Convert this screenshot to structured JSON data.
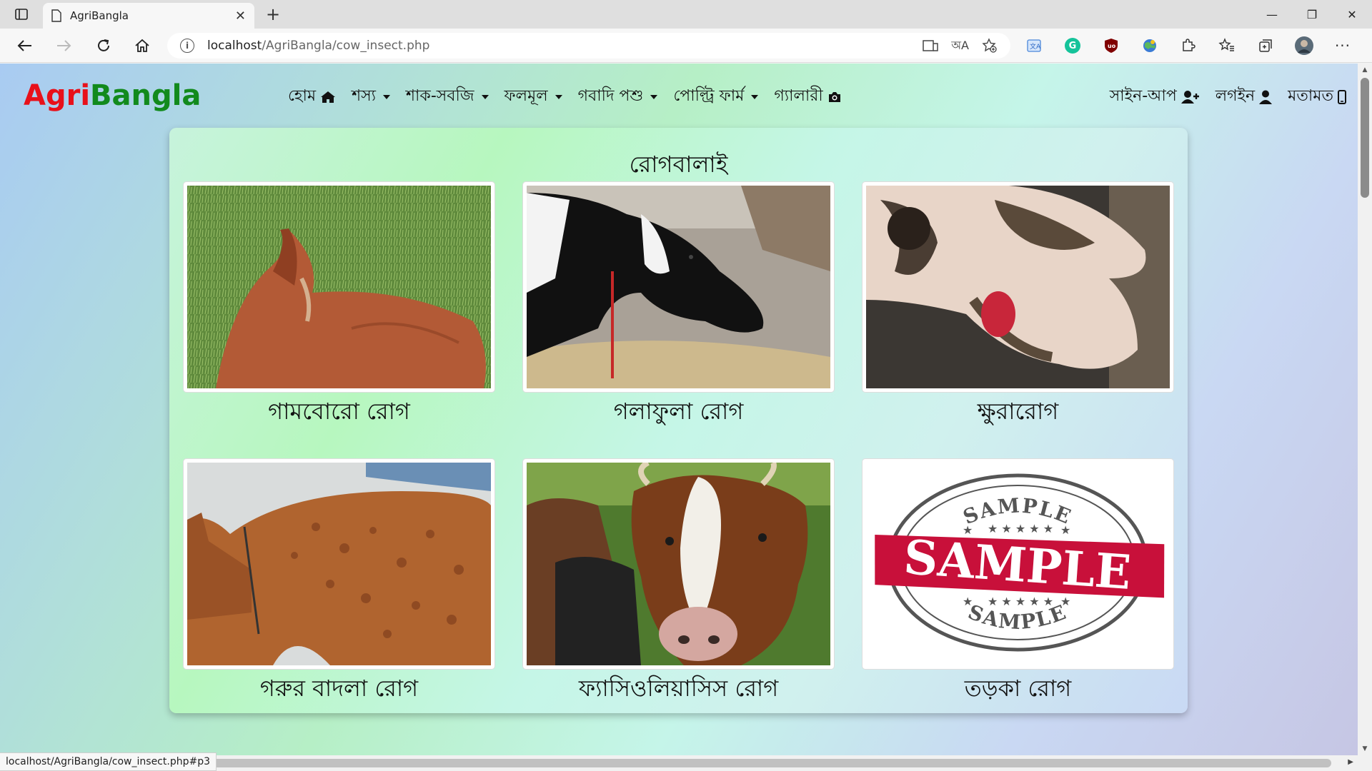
{
  "browser": {
    "tab_title": "AgriBangla",
    "url_host": "localhost",
    "url_path": "/AgriBangla/cow_insect.php",
    "status_url": "localhost/AgriBangla/cow_insect.php#p3",
    "read_aloud_label": "অA"
  },
  "site": {
    "logo_part1": "Agri",
    "logo_part2": "Bangla",
    "logo_colors": {
      "agri": "#e8101a",
      "bangla": "#128a1c"
    },
    "menu": [
      {
        "label": "হোম",
        "icon": "home-icon"
      },
      {
        "label": "শস্য",
        "icon": "caret-down-icon"
      },
      {
        "label": "শাক-সবজি",
        "icon": "caret-down-icon"
      },
      {
        "label": "ফলমূল",
        "icon": "caret-down-icon"
      },
      {
        "label": "গবাদি পশু",
        "icon": "caret-down-icon"
      },
      {
        "label": "পোল্ট্রি ফার্ম",
        "icon": "caret-down-icon"
      },
      {
        "label": "গ্যালারী",
        "icon": "camera-icon"
      }
    ],
    "right_menu": [
      {
        "label": "সাইন-আপ",
        "icon": "user-plus-icon"
      },
      {
        "label": "লগইন",
        "icon": "user-icon"
      },
      {
        "label": "মতামত",
        "icon": "mobile-icon"
      }
    ]
  },
  "main": {
    "title": "রোগবালাই",
    "diseases": [
      {
        "caption": "গামবোরো রোগ"
      },
      {
        "caption": "গলাফুলা রোগ"
      },
      {
        "caption": "ক্ষুরারোগ"
      },
      {
        "caption": "গরুর বাদলা রোগ"
      },
      {
        "caption": "ফ্যাসিওলিয়াসিস রোগ"
      },
      {
        "caption": "তড়কা রোগ"
      }
    ],
    "sample_stamp": {
      "center": "SAMPLE",
      "arc_top": "SAMPLE",
      "arc_bottom": "SAMPLE"
    }
  }
}
